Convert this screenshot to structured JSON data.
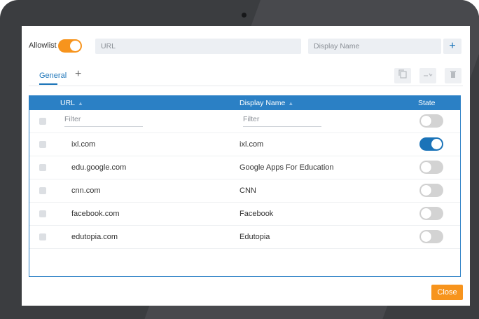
{
  "topbar": {
    "allowlist_label": "Allowlist",
    "url_placeholder": "URL",
    "display_name_placeholder": "Display Name",
    "add_label": "+"
  },
  "tabs": {
    "general_label": "General",
    "add_tab_label": "+"
  },
  "toolbar_icons": [
    "copy-icon",
    "transfer-icon",
    "trash-icon"
  ],
  "table": {
    "headers": {
      "url": "URL",
      "display_name": "Display Name",
      "state": "State"
    },
    "filter_placeholder": "Filter",
    "rows": [
      {
        "url": "ixl.com",
        "display_name": "ixl.com",
        "state": "on"
      },
      {
        "url": "edu.google.com",
        "display_name": "Google Apps For Education",
        "state": "off"
      },
      {
        "url": "cnn.com",
        "display_name": "CNN",
        "state": "off"
      },
      {
        "url": "facebook.com",
        "display_name": "Facebook",
        "state": "off"
      },
      {
        "url": "edutopia.com",
        "display_name": "Edutopia",
        "state": "off"
      }
    ]
  },
  "footer": {
    "close_label": "Close"
  },
  "colors": {
    "accent_blue": "#2b80c5",
    "accent_orange": "#f7941d"
  }
}
